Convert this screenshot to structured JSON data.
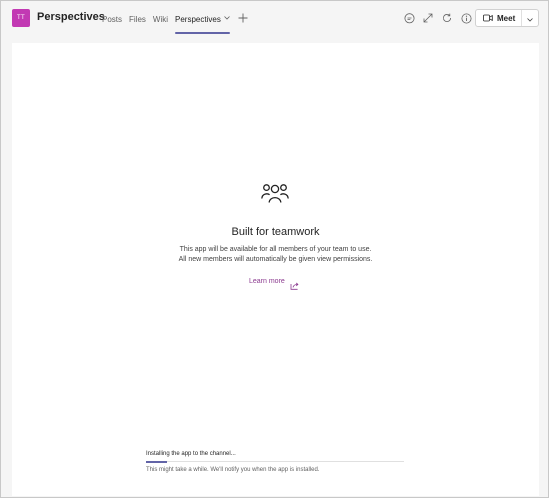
{
  "header": {
    "avatar_initials": "TT",
    "avatar_color": "#c239b3",
    "channel_title": "Perspectives",
    "tabs": [
      {
        "label": "Posts"
      },
      {
        "label": "Files"
      },
      {
        "label": "Wiki"
      },
      {
        "label": "Perspectives",
        "active": true
      }
    ],
    "add_tab_icon": "plus-icon",
    "icons": [
      "chat-icon",
      "expand-icon",
      "refresh-icon",
      "info-icon"
    ],
    "meet_label": "Meet"
  },
  "main": {
    "headline": "Built for teamwork",
    "description_line1": "This app will be available for all members of your team to use.",
    "description_line2": "All new members will automatically be given view permissions.",
    "learn_more_label": "Learn more",
    "accent_color": "#6264a7"
  },
  "install": {
    "status": "Installing the app to the channel...",
    "note": "This might take a while. We'll notify you when the app is installed.",
    "progress": 0.08
  }
}
